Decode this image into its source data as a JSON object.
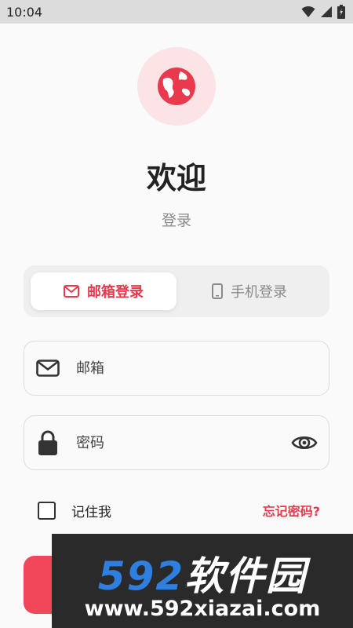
{
  "status_bar": {
    "time": "10:04",
    "icons": [
      "wifi-icon",
      "signal-icon",
      "battery-icon"
    ]
  },
  "header": {
    "logo_icon": "globe-icon",
    "title": "欢迎",
    "subtitle": "登录"
  },
  "tabs": [
    {
      "label": "邮箱登录",
      "icon": "mail-icon",
      "active": true
    },
    {
      "label": "手机登录",
      "icon": "phone-icon",
      "active": false
    }
  ],
  "form": {
    "email": {
      "placeholder": "邮箱",
      "value": "",
      "icon": "mail-icon"
    },
    "password": {
      "placeholder": "密码",
      "value": "",
      "icon": "lock-icon",
      "toggle_icon": "eye-icon"
    },
    "remember_label": "记住我",
    "remember_checked": false,
    "forgot_label": "忘记密码?"
  },
  "colors": {
    "accent": "#e8394d",
    "button": "#f2475a",
    "logo_bg": "#fbe3e6"
  },
  "watermark": {
    "brand_number": "592",
    "brand_text": "软件园",
    "url": "www.592xiazai.com"
  }
}
